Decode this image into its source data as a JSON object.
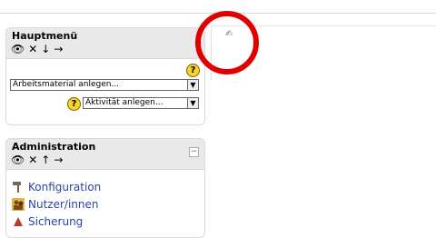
{
  "main_menu": {
    "title": "Hauptmenü",
    "controls": [
      "👁",
      "✕",
      "↓",
      "→"
    ],
    "resource_select": "Arbeitsmaterial anlegen...",
    "activity_select": "Aktivität anlegen...",
    "help_glyph": "?"
  },
  "admin": {
    "title": "Administration",
    "controls": [
      "👁",
      "✕",
      "↑",
      "→"
    ],
    "collapse_glyph": "−",
    "items": [
      {
        "label": "Konfiguration",
        "icon": "hammer-icon"
      },
      {
        "label": "Nutzer/innen",
        "icon": "users-icon"
      },
      {
        "label": "Sicherung",
        "icon": "backup-icon"
      }
    ]
  },
  "content": {
    "edit_glyph": "✍"
  },
  "colors": {
    "link": "#2a46a5",
    "header_bg": "#e9e9e9",
    "help_yellow": "#f7d32b",
    "annotation_red": "#e00000"
  }
}
